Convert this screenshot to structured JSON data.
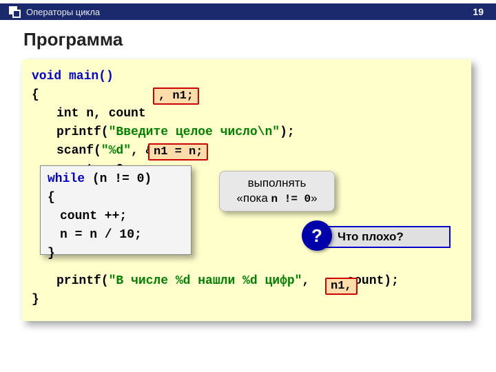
{
  "topbar": {
    "title": "Операторы цикла",
    "page": "19"
  },
  "heading": "Программа",
  "code": {
    "sig": "void main()",
    "decl_prefix": "int n, count",
    "print1_prefix": "printf(",
    "print1_str": "\"Введите целое число\\n\"",
    "print1_suffix": ");",
    "scan_prefix": "scanf(",
    "scan_str": "\"%d\"",
    "scan_suffix": ", &n);",
    "count_zero": "count = 0; ",
    "while_kw": "while",
    "while_cond": " (n != 0)",
    "lbrace": "{",
    "body1": "count ++;",
    "body2": "n = n / 10;",
    "rbrace": "}",
    "print2_prefix": "printf(",
    "print2_str": "\"В числе %d нашли %d цифр\"",
    "print2_gap": ",     ",
    "print2_count": "count);"
  },
  "badges": {
    "n1_decl": ", n1;",
    "n1_assign": "n1 = n;",
    "n1_call": "n1,"
  },
  "callout": {
    "line1": "выполнять",
    "line2_a": "«пока ",
    "line2_b": "n != 0",
    "line2_c": "»"
  },
  "question": {
    "mark": "?",
    "text": "Что плохо?"
  }
}
